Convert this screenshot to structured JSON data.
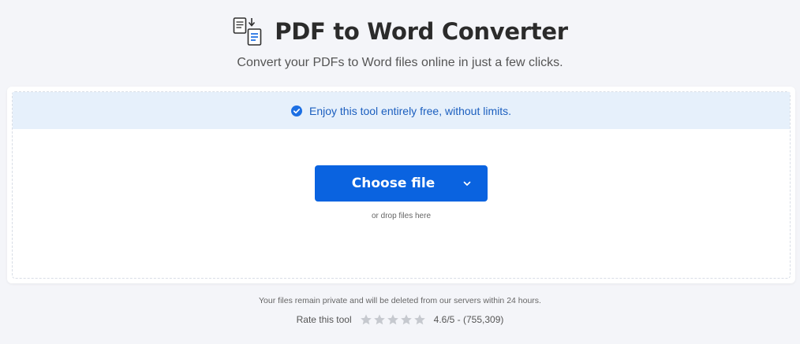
{
  "header": {
    "title": "PDF to Word Converter",
    "subtitle": "Convert your PDFs to Word files online in just a few clicks.",
    "icon": "pdf-to-word-icon"
  },
  "banner": {
    "text": "Enjoy this tool entirely free, without limits.",
    "icon": "check-circle-icon",
    "color": "#1c5fbf"
  },
  "upload": {
    "button_label": "Choose file",
    "button_icon": "chevron-down-icon",
    "drop_hint": "or drop files here",
    "accent_color": "#0a63e0"
  },
  "footer": {
    "privacy_text": "Your files remain private and will be deleted from our servers within 24 hours.",
    "rate_label": "Rate this tool",
    "rating_text": "4.6/5 - (755,309)",
    "stars": 5
  }
}
